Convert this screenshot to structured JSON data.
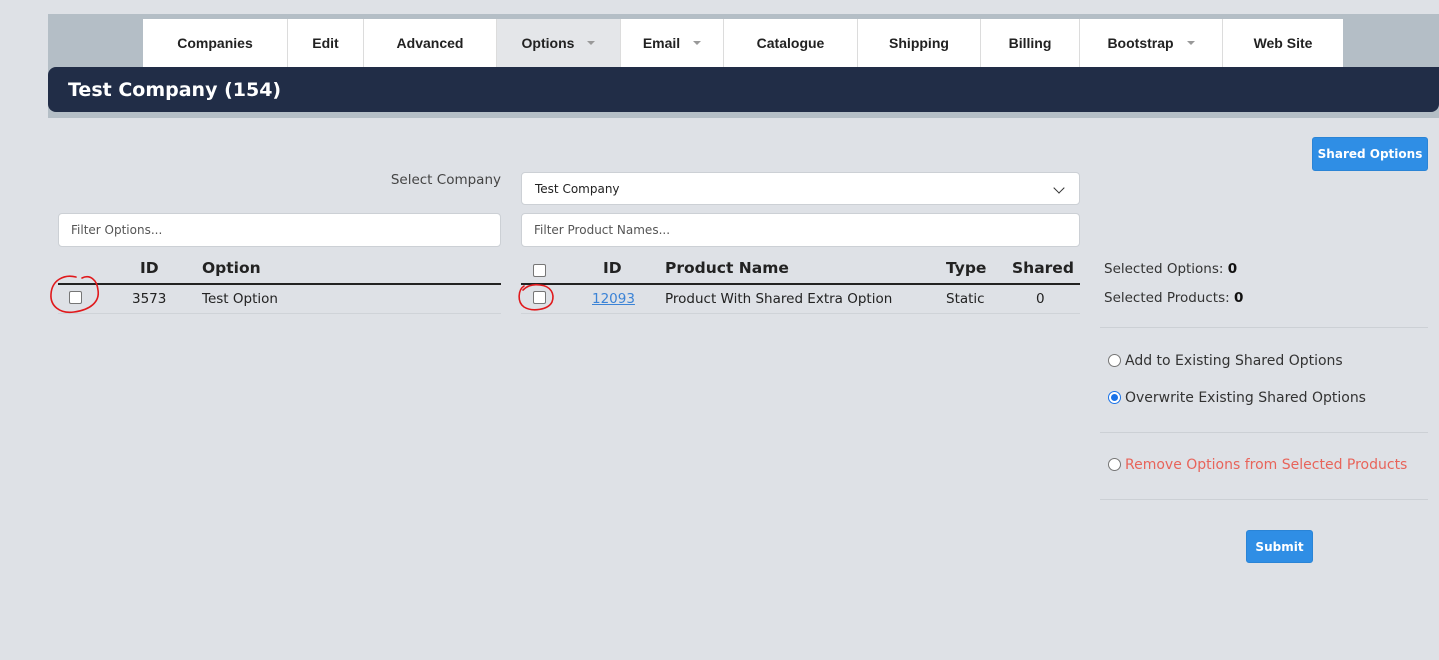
{
  "tabs": [
    {
      "label": "Companies",
      "dropdown": false,
      "active": false
    },
    {
      "label": "Edit",
      "dropdown": false,
      "active": false
    },
    {
      "label": "Advanced",
      "dropdown": false,
      "active": false
    },
    {
      "label": "Options",
      "dropdown": true,
      "active": true
    },
    {
      "label": "Email",
      "dropdown": true,
      "active": false
    },
    {
      "label": "Catalogue",
      "dropdown": false,
      "active": false
    },
    {
      "label": "Shipping",
      "dropdown": false,
      "active": false
    },
    {
      "label": "Billing",
      "dropdown": false,
      "active": false
    },
    {
      "label": "Bootstrap",
      "dropdown": true,
      "active": false
    },
    {
      "label": "Web Site",
      "dropdown": false,
      "active": false
    }
  ],
  "page_title": "Test Company (154)",
  "shared_options_button": "Shared Options",
  "company_select": {
    "label": "Select Company",
    "value": "Test Company"
  },
  "filters": {
    "options_placeholder": "Filter Options...",
    "products_placeholder": "Filter Product Names..."
  },
  "options_table": {
    "headers": {
      "id": "ID",
      "option": "Option"
    },
    "rows": [
      {
        "id": "3573",
        "option": "Test Option",
        "checked": false
      }
    ]
  },
  "products_table": {
    "headers": {
      "id": "ID",
      "name": "Product Name",
      "type": "Type",
      "shared": "Shared"
    },
    "rows": [
      {
        "id": "12093",
        "name": "Product With Shared Extra Option",
        "type": "Static",
        "shared": "0",
        "checked": false
      }
    ]
  },
  "summary": {
    "selected_options_label": "Selected Options:",
    "selected_options_count": "0",
    "selected_products_label": "Selected Products:",
    "selected_products_count": "0"
  },
  "mode_options": [
    {
      "label": "Add to Existing Shared Options",
      "selected": false
    },
    {
      "label": "Overwrite Existing Shared Options",
      "selected": true
    },
    {
      "label": "Remove Options from Selected Products",
      "selected": false
    }
  ],
  "submit_button": "Submit",
  "colors": {
    "accent": "#2f8ee5",
    "header_bg": "#212d47",
    "danger": "#e8645a",
    "annotation": "#e0191c"
  }
}
